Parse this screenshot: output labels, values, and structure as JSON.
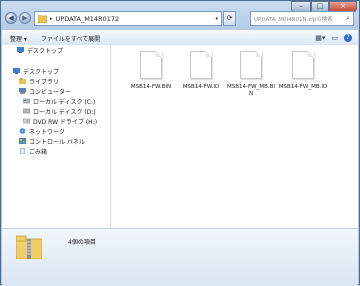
{
  "address": {
    "folder_label": "UPDATA_M14R0172"
  },
  "search": {
    "placeholder": "UPDATA_M0I4R01N.zipの検索"
  },
  "toolbar": {
    "organize_label": "整理 ▾",
    "extract_label": "ファイルをすべて展開"
  },
  "nav": [
    {
      "label": "デスクトップ",
      "icon": "desktop-icon"
    },
    {
      "label": "デスクトップ",
      "icon": "desktop-icon"
    },
    {
      "label": "ライブラリ",
      "icon": "library-icon"
    },
    {
      "label": "コンピューター",
      "icon": "computer-icon"
    },
    {
      "label": "ローカル ディスク (C:)",
      "icon": "drive-icon"
    },
    {
      "label": "ローカル ディスク (D:)",
      "icon": "drive-icon"
    },
    {
      "label": "DVD RW ドライブ (H:)",
      "icon": "dvd-icon"
    },
    {
      "label": "ネットワーク",
      "icon": "network-icon"
    },
    {
      "label": "コントロール パネル",
      "icon": "control-panel-icon"
    },
    {
      "label": "ごみ箱",
      "icon": "recycle-bin-icon"
    }
  ],
  "files": [
    {
      "name": "MSB14-FW.BIN"
    },
    {
      "name": "MSB14-FW.ID"
    },
    {
      "name": "MSB14-FW_MB.BIN"
    },
    {
      "name": "MSB14-FW_MB.ID"
    }
  ],
  "details": {
    "count_label": "4個の項目"
  }
}
